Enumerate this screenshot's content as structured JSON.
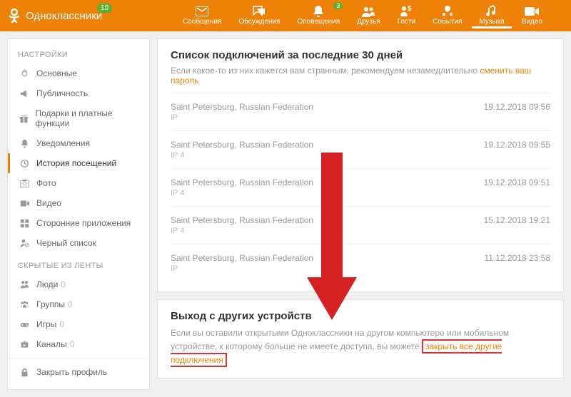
{
  "header": {
    "brand": "Одноклассники",
    "brand_badge": "10",
    "nav": [
      {
        "label": "Сообщения",
        "icon": "mail",
        "badge": ""
      },
      {
        "label": "Обсуждения",
        "icon": "chat",
        "badge": ""
      },
      {
        "label": "Оповещения",
        "icon": "bell",
        "badge": "3"
      },
      {
        "label": "Друзья",
        "icon": "friends",
        "badge": ""
      },
      {
        "label": "Гости",
        "icon": "guests",
        "badge": ""
      },
      {
        "label": "События",
        "icon": "events",
        "badge": ""
      },
      {
        "label": "Музыка",
        "icon": "music",
        "badge": "",
        "active": true
      },
      {
        "label": "Видео",
        "icon": "video",
        "badge": ""
      }
    ]
  },
  "sidebar": {
    "heading1": "НАСТРОЙКИ",
    "items1": [
      {
        "label": "Основные",
        "icon": "gear"
      },
      {
        "label": "Публичность",
        "icon": "megaphone"
      },
      {
        "label": "Подарки и платные функции",
        "icon": "gift"
      },
      {
        "label": "Уведомления",
        "icon": "bell"
      },
      {
        "label": "История посещений",
        "icon": "history",
        "active": true
      },
      {
        "label": "Фото",
        "icon": "photo"
      },
      {
        "label": "Видео",
        "icon": "video"
      },
      {
        "label": "Сторонние приложения",
        "icon": "apps"
      },
      {
        "label": "Черный список",
        "icon": "blacklist"
      }
    ],
    "heading2": "СКРЫТЫЕ ИЗ ЛЕНТЫ",
    "items2": [
      {
        "label": "Люди",
        "count": "0",
        "icon": "people"
      },
      {
        "label": "Группы",
        "count": "0",
        "icon": "groups"
      },
      {
        "label": "Игры",
        "count": "0",
        "icon": "games"
      },
      {
        "label": "Каналы",
        "count": "0",
        "icon": "channels"
      }
    ],
    "close_profile": "Закрыть профиль"
  },
  "connections": {
    "title": "Список подключений за последние 30 дней",
    "subtitle_a": "Если какое-то из них кажется вам странным, рекомендуем незамедлительно ",
    "subtitle_link": "сменить ваш пароль",
    "ip_label": "IP",
    "sessions": [
      {
        "loc": "Saint Petersburg, Russian Federation",
        "ip": "",
        "date": "19.12.2018 09:56"
      },
      {
        "loc": "Saint Petersburg, Russian Federation",
        "ip": "4",
        "date": "19.12.2018 09:55"
      },
      {
        "loc": "Saint Petersburg, Russian Federation",
        "ip": "4",
        "date": "19.12.2018 09:51"
      },
      {
        "loc": "Saint Petersburg, Russian Federation",
        "ip": "4",
        "date": "15.12.2018 19:21"
      },
      {
        "loc": "Saint Petersburg, Russian Federation",
        "ip": "",
        "date": "11.12.2018 23:58"
      }
    ]
  },
  "logout": {
    "title": "Выход с других устройств",
    "text_a": "Если вы оставили открытыми Одноклассники на другом компьютере или мобильном устройстве, к которому больше не имеете доступа, вы можете ",
    "link": "закрыть все другие подключения"
  }
}
